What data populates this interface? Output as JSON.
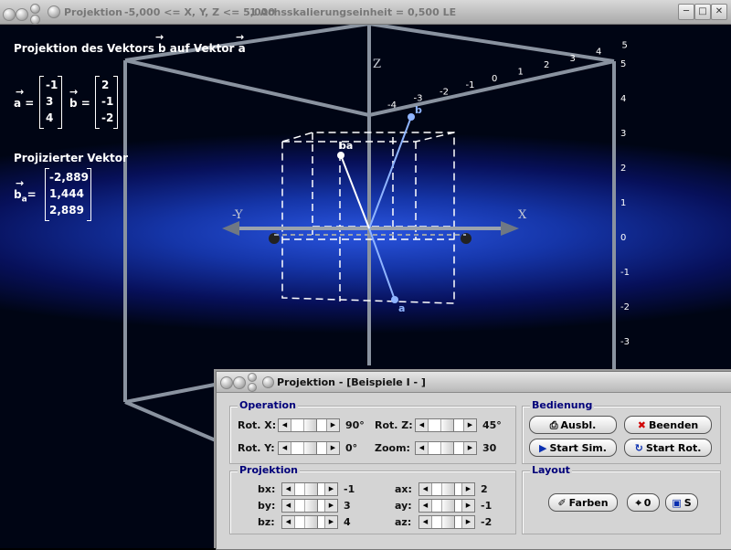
{
  "main_window": {
    "title": "Projektion",
    "range_info": "-5,000 <= X, Y, Z <= 5,000",
    "scale_info": "1 Achsskalierungseinheit = 0,500 LE",
    "button_icons": [
      "minimize-icon",
      "maximize-icon",
      "close-icon"
    ]
  },
  "overlay": {
    "heading": "Projektion des Vektors b auf Vektor a",
    "vector_a_label": "a =",
    "vector_a": [
      "-1",
      "3",
      "4"
    ],
    "vector_b_label": "b =",
    "vector_b": [
      "2",
      "-1",
      "-2"
    ],
    "projected_heading": "Projizierter Vektor",
    "vector_ba_label": "b",
    "vector_ba_subscript": "a",
    "vector_ba_eq": "=",
    "vector_ba": [
      "-2,889",
      "1,444",
      "2,889"
    ],
    "arrow_glyph": "→"
  },
  "scene": {
    "axis_x_label": "X",
    "axis_neg_x_label": "-X",
    "axis_y_label": "Y",
    "axis_neg_y_label": "-Y",
    "axis_z_label": "Z",
    "top_ticks": [
      "-4",
      "-3",
      "-2",
      "-1",
      "0",
      "1",
      "2",
      "3",
      "4",
      "5"
    ],
    "right_ticks": [
      "5",
      "4",
      "3",
      "2",
      "1",
      "0",
      "-1",
      "-2",
      "-3",
      "-4"
    ],
    "point_labels": {
      "b": "b",
      "a": "a",
      "ba": "ba"
    },
    "colors": {
      "vector_ab": "#8fb4ff",
      "projection": "#ffffff",
      "box_edges": "#7f8894"
    }
  },
  "dialog": {
    "title": "Projektion - [Beispiele I - ]",
    "operation": {
      "title": "Operation",
      "rot_x_label": "Rot. X:",
      "rot_x_value": "90°",
      "rot_x_level": 0.5,
      "rot_y_label": "Rot. Y:",
      "rot_y_value": "0°",
      "rot_y_level": 0.5,
      "rot_z_label": "Rot. Z:",
      "rot_z_value": "45°",
      "rot_z_level": 0.5,
      "zoom_label": "Zoom:",
      "zoom_value": "30",
      "zoom_level": 0.5
    },
    "bedienung": {
      "title": "Bedienung",
      "ausbl": "Ausbl.",
      "beenden": "Beenden",
      "start_sim": "Start Sim.",
      "start_rot": "Start Rot."
    },
    "projektion": {
      "title": "Projektion",
      "bx_label": "bx:",
      "bx_value": "-1",
      "by_label": "by:",
      "by_value": "3",
      "bz_label": "bz:",
      "bz_value": "4",
      "ax_label": "ax:",
      "ax_value": "2",
      "ay_label": "ay:",
      "ay_value": "-1",
      "az_label": "az:",
      "az_value": "-2"
    },
    "layout": {
      "title": "Layout",
      "farben": "Farben",
      "reset": "0",
      "s": "S"
    }
  }
}
